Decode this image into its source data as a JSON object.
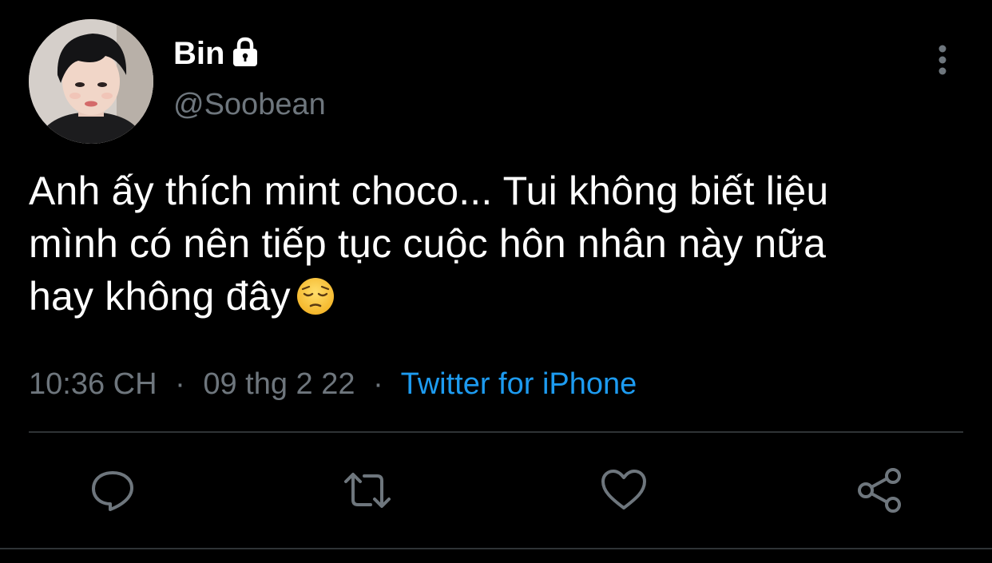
{
  "tweet": {
    "author": {
      "name": "Bin",
      "handle": "@Soobean",
      "protected_icon": "lock-icon",
      "avatar_icon": "avatar-photo"
    },
    "text_lines": [
      "Anh ấy thích mint choco... Tui không biết liệu",
      "mình có nên tiếp tục cuộc hôn nhân này nữa",
      "hay không đây"
    ],
    "emoji": "pensive-face",
    "time": "10:36 CH",
    "date": "09 thg 2 22",
    "separator": "·",
    "source": "Twitter for iPhone",
    "actions": [
      "reply-icon",
      "retweet-icon",
      "like-icon",
      "share-icon"
    ],
    "colors": {
      "background": "#000000",
      "text": "#ffffff",
      "muted": "#6e767d",
      "link": "#1d9bf0",
      "divider": "#2f3336"
    }
  }
}
